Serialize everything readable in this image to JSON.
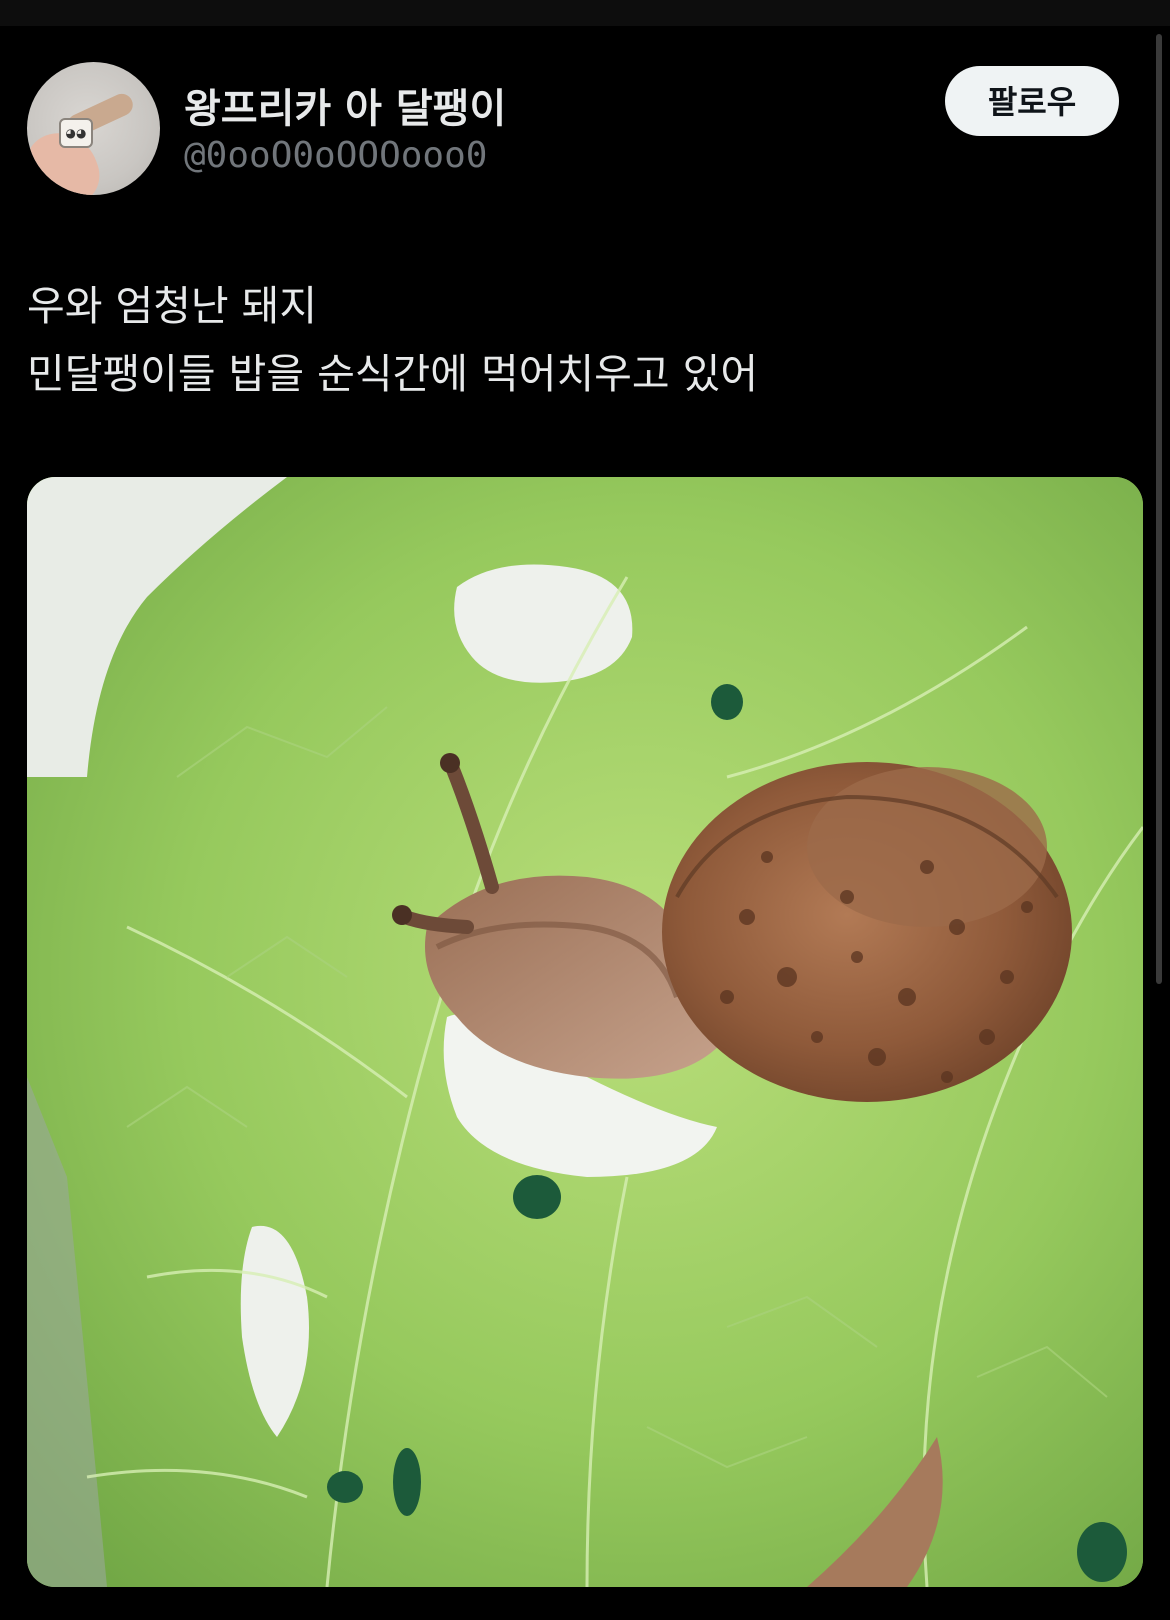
{
  "author": {
    "display_name": "왕프리카 아 달팽이",
    "handle": "@0ooO0oOOOooo0",
    "avatar_icon": "snail-avatar-icon"
  },
  "follow_button": {
    "label": "팔로우"
  },
  "tweet": {
    "lines": [
      "우와 엄청난 돼지",
      "민달팽이들 밥을 순식간에 먹어치우고 있어"
    ]
  },
  "media": {
    "icon": "snail-on-lettuce-photo"
  },
  "colors": {
    "background": "#000000",
    "text": "#e7e9ea",
    "secondary_text": "#71767b",
    "follow_button_bg": "#eff3f4",
    "follow_button_text": "#0f1419"
  }
}
